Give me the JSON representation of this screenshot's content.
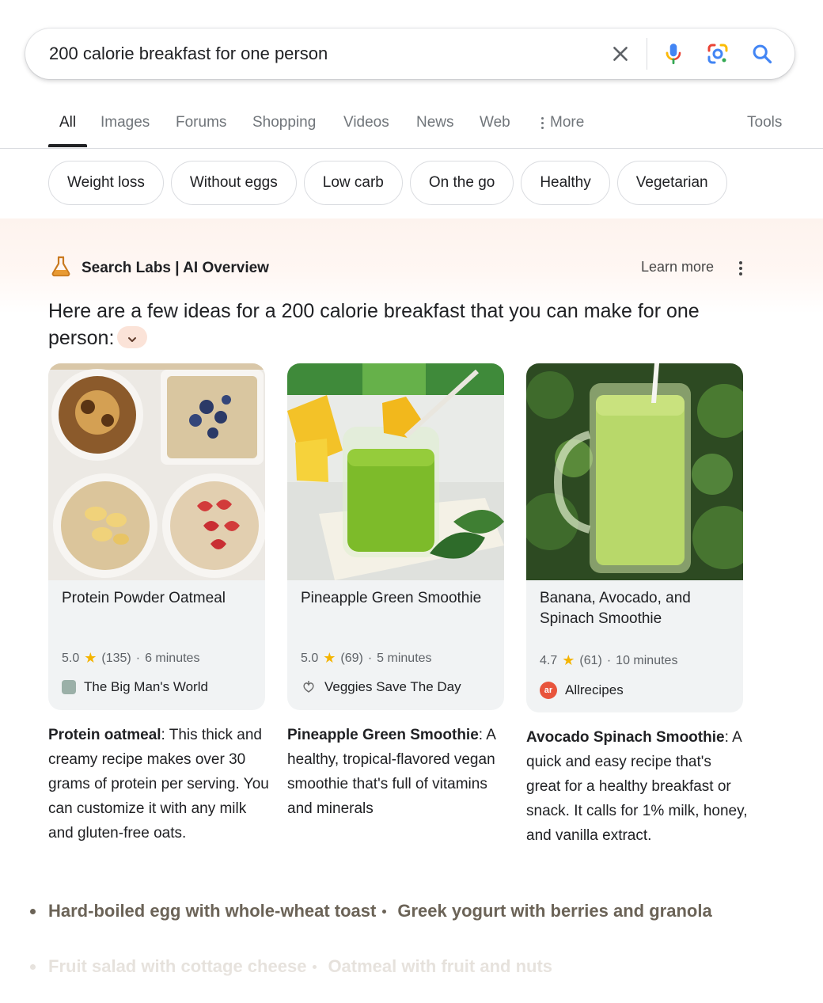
{
  "search": {
    "query": "200 calorie breakfast for one person",
    "clear_icon": "close-icon",
    "mic_icon": "microphone-icon",
    "lens_icon": "google-lens-icon",
    "search_icon": "search-icon"
  },
  "tabs": [
    {
      "label": "All",
      "active": true
    },
    {
      "label": "Images"
    },
    {
      "label": "Forums"
    },
    {
      "label": "Shopping"
    },
    {
      "label": "Videos"
    },
    {
      "label": "News"
    },
    {
      "label": "Web"
    },
    {
      "label": "More"
    }
  ],
  "tools_label": "Tools",
  "chips": [
    "Weight loss",
    "Without eggs",
    "Low carb",
    "On the go",
    "Healthy",
    "Vegetarian"
  ],
  "ai_overview": {
    "title": "Search Labs | AI Overview",
    "learn_more": "Learn more",
    "intro": "Here are a few ideas for a 200 calorie breakfast that you can make for one person:",
    "cards": [
      {
        "title": "Protein Powder Oatmeal",
        "rating": "5.0",
        "reviews": "(135)",
        "time": "6 minutes",
        "source": "The Big Man's World",
        "source_icon": "big-mans-world-logo-icon",
        "desc_bold": "Protein oatmeal",
        "desc": ": This thick and creamy recipe makes over 30 grams of protein per serving. You can customize it with any milk and gluten-free oats."
      },
      {
        "title": "Pineapple Green Smoothie",
        "rating": "5.0",
        "reviews": "(69)",
        "time": "5 minutes",
        "source": "Veggies Save The Day",
        "source_icon": "veggies-save-the-day-logo-icon",
        "desc_bold": "Pineapple Green Smoothie",
        "desc": ": A healthy, tropical-flavored vegan smoothie that's full of vitamins and minerals"
      },
      {
        "title": "Banana, Avocado, and Spinach Smoothie",
        "rating": "4.7",
        "reviews": "(61)",
        "time": "10 minutes",
        "source": "Allrecipes",
        "source_icon": "allrecipes-logo-icon",
        "desc_bold": "Avocado Spinach Smoothie",
        "desc": ": A quick and easy recipe that's great for a healthy breakfast or snack. It calls for 1% milk, honey, and vanilla extract."
      }
    ],
    "bullets_row1": [
      "Hard-boiled egg with whole-wheat toast",
      "Greek yogurt with berries and granola"
    ],
    "bullets_row2": [
      "Fruit salad with cottage cheese",
      "Oatmeal with fruit and nuts"
    ]
  },
  "colors": {
    "accent_blue": "#4285f4",
    "star": "#f4b400",
    "ai_bg": "#fdf3ee",
    "allrecipes": "#e8543c"
  }
}
